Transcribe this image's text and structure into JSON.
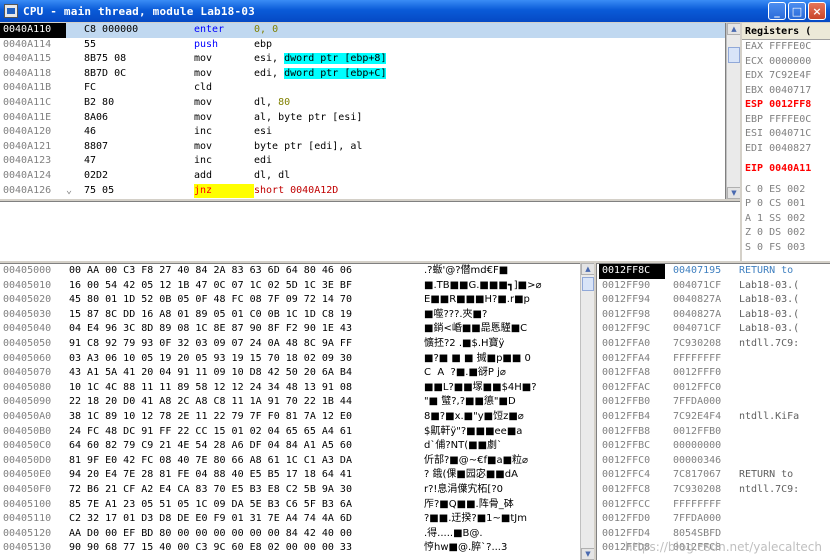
{
  "window": {
    "title": "CPU - main thread, module Lab18-03",
    "buttons": {
      "minimize": "_",
      "maximize": "□",
      "close": "×"
    }
  },
  "disasm": [
    {
      "addr": "0040A110",
      "mark": "",
      "hex": "C8 000000",
      "mnem": "enter",
      "ops": [
        [
          "0, ",
          "num"
        ],
        [
          "0",
          "num"
        ]
      ],
      "current": true
    },
    {
      "addr": "0040A114",
      "mark": "",
      "hex": "55",
      "mnem": "push",
      "ops": [
        [
          "ebp",
          ""
        ]
      ]
    },
    {
      "addr": "0040A115",
      "mark": "",
      "hex": "8B75 08",
      "mnem": "mov",
      "ops": [
        [
          "esi, ",
          ""
        ],
        [
          "dword ptr [ebp+8]",
          "mem"
        ]
      ]
    },
    {
      "addr": "0040A118",
      "mark": "",
      "hex": "8B7D 0C",
      "mnem": "mov",
      "ops": [
        [
          "edi, ",
          ""
        ],
        [
          "dword ptr [ebp+C]",
          "mem"
        ]
      ]
    },
    {
      "addr": "0040A11B",
      "mark": "",
      "hex": "FC",
      "mnem": "cld",
      "ops": []
    },
    {
      "addr": "0040A11C",
      "mark": "",
      "hex": "B2 80",
      "mnem": "mov",
      "ops": [
        [
          "dl, ",
          ""
        ],
        [
          "80",
          "num"
        ]
      ]
    },
    {
      "addr": "0040A11E",
      "mark": "",
      "hex": "8A06",
      "mnem": "mov",
      "ops": [
        [
          "al, byte ptr [esi]",
          ""
        ]
      ]
    },
    {
      "addr": "0040A120",
      "mark": "",
      "hex": "46",
      "mnem": "inc",
      "ops": [
        [
          "esi",
          ""
        ]
      ]
    },
    {
      "addr": "0040A121",
      "mark": "",
      "hex": "8807",
      "mnem": "mov",
      "ops": [
        [
          "byte ptr [edi], al",
          ""
        ]
      ]
    },
    {
      "addr": "0040A123",
      "mark": "",
      "hex": "47",
      "mnem": "inc",
      "ops": [
        [
          "edi",
          ""
        ]
      ]
    },
    {
      "addr": "0040A124",
      "mark": "",
      "hex": "02D2",
      "mnem": "add",
      "ops": [
        [
          "dl, dl",
          ""
        ]
      ]
    },
    {
      "addr": "0040A126",
      "mark": "⌄",
      "hex": "75 05",
      "mnem": "jnz",
      "ops": [
        [
          "short 0040A12D",
          "red"
        ]
      ],
      "jump": true
    }
  ],
  "registers": {
    "header": "Registers (",
    "rows": [
      {
        "name": "EAX",
        "value": "FFFFE0C"
      },
      {
        "name": "ECX",
        "value": "0000000"
      },
      {
        "name": "EDX",
        "value": "7C92E4F"
      },
      {
        "name": "EBX",
        "value": "0040717"
      },
      {
        "name": "ESP",
        "value": "0012FF8",
        "changed": true
      },
      {
        "name": "EBP",
        "value": "FFFFE0C"
      },
      {
        "name": "ESI",
        "value": "004071C"
      },
      {
        "name": "EDI",
        "value": "0040827"
      },
      {
        "gap": true
      },
      {
        "name": "EIP",
        "value": "0040A11",
        "changed": true
      },
      {
        "gap": true
      },
      {
        "name": "C 0",
        "value": "ES 002"
      },
      {
        "name": "P 0",
        "value": "CS 001"
      },
      {
        "name": "A 1",
        "value": "SS 002"
      },
      {
        "name": "Z 0",
        "value": "DS 002"
      },
      {
        "name": "S 0",
        "value": "FS 003"
      }
    ]
  },
  "dump": [
    {
      "addr": "00405000",
      "hex": "00 AA 00 C3 F8 27 40 84 2A 83 63 6D 64 80 46 06",
      "ascii": ".?蝂'@?僣md€F■"
    },
    {
      "addr": "00405010",
      "hex": "16 00 54 42 05 12 1B 47 0C 07 1C 02 5D 1C 3E BF",
      "ascii": "■.TB■■G.■■■┓]■>⌀"
    },
    {
      "addr": "00405020",
      "hex": "45 80 01 1D 52 0B 05 0F 48 FC 08 7F 09 72 14 70",
      "ascii": "E■■R■■■H?■.r■p"
    },
    {
      "addr": "00405030",
      "hex": "15 87 8C DD 16 A8 01 89 05 01 C0 0B 1C 1D C8 19",
      "ascii": "■噬???.夾■?"
    },
    {
      "addr": "00405040",
      "hex": "04 E4 96 3C 8D 89 08 1C 8E 87 90 8F F2 90 1E 43",
      "ascii": "■鋿<崏■■巼悘騹■C"
    },
    {
      "addr": "00405050",
      "hex": "91 C8 92 79 93 0F 32 03 09 07 24 0A 48 8C 9A FF",
      "ascii": "懭抷?2 .■$.H寶ÿ"
    },
    {
      "addr": "00405060",
      "hex": "03 A3 06 10 05 19 20 05 93 19 15 70 18 02 09 30",
      "ascii": "■?■ ■ ■ 搣■p■■ 0"
    },
    {
      "addr": "00405070",
      "hex": "43 A1 5A 41 20 04 91 11 09 10 D8 42 50 20 6A B4",
      "ascii": "C  A  ?■.■谺P j⌀"
    },
    {
      "addr": "00405080",
      "hex": "10 1C 4C 88 11 11 89 58 12 12 24 34 48 13 91 08",
      "ascii": "■■L?■■塜■■$4H■?"
    },
    {
      "addr": "00405090",
      "hex": "22 18 20 D0 41 A8 2C A8 C8 11 1A 91 70 22 1B 44",
      "ascii": "\"■ 蠥?,?■■憄\"■D"
    },
    {
      "addr": "004050A0",
      "hex": "38 1C 89 10 12 78 2E 11 22 79 7F F0 81 7A 12 E0",
      "ascii": "8■?■x.■\"y■饾z■⌀"
    },
    {
      "addr": "004050B0",
      "hex": "24 FC 48 DC 91 FF 22 CC 15 01 02 04 65 65 A4 61",
      "ascii": "$鼿軒ÿ\"?■■■ee■a"
    },
    {
      "addr": "004050C0",
      "hex": "64 60 82 79 C9 21 4E 54 28 A6 DF 04 84 A1 A5 60",
      "ascii": "d`俌?NT(■■劇`"
    },
    {
      "addr": "004050D0",
      "hex": "81 9F E0 42 FC 08 40 7E 80 66 A8 61 1C C1 A3 DA",
      "ascii": "伒郆?■@~€f■a■粒⌀"
    },
    {
      "addr": "004050E0",
      "hex": "94 20 E4 7E 28 81 FE 04 88 40 E5 B5 17 18 64 41",
      "ascii": "? 鋨(倮■园宓■■dA"
    },
    {
      "addr": "004050F0",
      "hex": "72 B6 21 CF A2 E4 CA 83 70 E5 B3 E8 C2 5B 9A 30",
      "ascii": "r?!息涓僷宄柘[?0"
    },
    {
      "addr": "00405100",
      "hex": "85 7E A1 23 05 51 05 1C 09 DA 5E B3 C6 5F B3 6A",
      "ascii": "厏?■Q■■.阵骨_砵"
    },
    {
      "addr": "00405110",
      "hex": "C2 32 17 01 D3 D8 DE E0 F9 01 31 7E A4 74 4A 6D",
      "ascii": "?■■.迂揆?■1~■tJm"
    },
    {
      "addr": "00405120",
      "hex": "AA D0 00 EF BD 80 00 00 00 00 00 00 84 42 40 00",
      "ascii": ".得.....■B@."
    },
    {
      "addr": "00405130",
      "hex": "90 90 68 77 15 40 00 C3 9C 60 E8 02 00 00 00 33",
      "ascii": "悙hw■@.脺`?...3"
    }
  ],
  "stack": [
    {
      "addr": "0012FF8C",
      "val": "00407195",
      "cmt": "RETURN to",
      "top": true
    },
    {
      "addr": "0012FF90",
      "val": "004071CF",
      "cmt": "Lab18-03.("
    },
    {
      "addr": "0012FF94",
      "val": "0040827A",
      "cmt": "Lab18-03.("
    },
    {
      "addr": "0012FF98",
      "val": "0040827A",
      "cmt": "Lab18-03.("
    },
    {
      "addr": "0012FF9C",
      "val": "004071CF",
      "cmt": "Lab18-03.("
    },
    {
      "addr": "0012FFA0",
      "val": "7C930208",
      "cmt": "ntdll.7C9:"
    },
    {
      "addr": "0012FFA4",
      "val": "FFFFFFFF",
      "cmt": ""
    },
    {
      "addr": "0012FFA8",
      "val": "0012FFF0",
      "cmt": ""
    },
    {
      "addr": "0012FFAC",
      "val": "0012FFC0",
      "cmt": ""
    },
    {
      "addr": "0012FFB0",
      "val": "7FFDA000",
      "cmt": ""
    },
    {
      "addr": "0012FFB4",
      "val": "7C92E4F4",
      "cmt": "ntdll.KiFa"
    },
    {
      "addr": "0012FFB8",
      "val": "0012FFB0",
      "cmt": ""
    },
    {
      "addr": "0012FFBC",
      "val": "00000000",
      "cmt": ""
    },
    {
      "addr": "0012FFC0",
      "val": "00000346",
      "cmt": ""
    },
    {
      "addr": "0012FFC4",
      "val": "7C817067",
      "cmt": "RETURN to"
    },
    {
      "addr": "0012FFC8",
      "val": "7C930208",
      "cmt": "ntdll.7C9:"
    },
    {
      "addr": "0012FFCC",
      "val": "FFFFFFFF",
      "cmt": ""
    },
    {
      "addr": "0012FFD0",
      "val": "7FFDA000",
      "cmt": ""
    },
    {
      "addr": "0012FFD4",
      "val": "8054SBFD",
      "cmt": ""
    },
    {
      "addr": "0012FFD8",
      "val": "0012FFC8",
      "cmt": ""
    }
  ],
  "watermark": "https://blog.csdn.net/yalecaltech",
  "colors": {
    "titlebar": "#0a5bd8",
    "current_row": "#c0d8f0",
    "mem_highlight": "#00ffff",
    "jump_mnemonic": "#ff0000",
    "changed_register": "#ff0000"
  }
}
